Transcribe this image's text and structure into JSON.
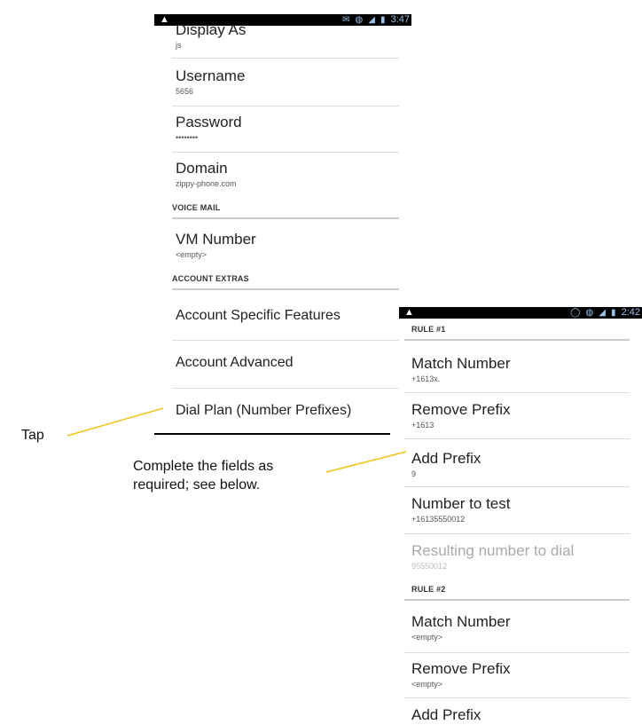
{
  "phone1": {
    "status_time": "3:47",
    "display_as": {
      "title": "Display As",
      "value": "js"
    },
    "username": {
      "title": "Username",
      "value": "5656"
    },
    "password": {
      "title": "Password",
      "value": "••••••••"
    },
    "domain": {
      "title": "Domain",
      "value": "zippy-phone.com"
    },
    "voice_mail_header": "VOICE MAIL",
    "vm_number": {
      "title": "VM Number",
      "value": "<empty>"
    },
    "account_extras_header": "ACCOUNT EXTRAS",
    "account_specific": "Account Specific Features",
    "account_advanced": "Account Advanced",
    "dial_plan": "Dial Plan (Number Prefixes)"
  },
  "phone2": {
    "status_time": "2:42",
    "rule1_header": "RULE #1",
    "match_number_1": {
      "title": "Match Number",
      "value": "+1613x."
    },
    "remove_prefix_1": {
      "title": "Remove Prefix",
      "value": "+1613"
    },
    "add_prefix_1": {
      "title": "Add Prefix",
      "value": "9"
    },
    "number_to_test": {
      "title": "Number to test",
      "value": "+16135550012"
    },
    "resulting_number": {
      "title": "Resulting number to dial",
      "value": "95550012"
    },
    "rule2_header": "RULE #2",
    "match_number_2": {
      "title": "Match Number",
      "value": "<empty>"
    },
    "remove_prefix_2": {
      "title": "Remove Prefix",
      "value": "<empty>"
    },
    "add_prefix_2": {
      "title": "Add Prefix"
    }
  },
  "annotations": {
    "tap": "Tap",
    "complete_line1": "Complete the fields as",
    "complete_line2": "required; see below."
  },
  "colors": {
    "pointer": "#f0c419",
    "statusbar": "#000000",
    "statusbar_text": "#9ac0e6"
  },
  "icons": [
    "warning-icon",
    "vibrate-icon",
    "wifi-icon",
    "signal-icon",
    "battery-icon",
    "sync-icon"
  ]
}
